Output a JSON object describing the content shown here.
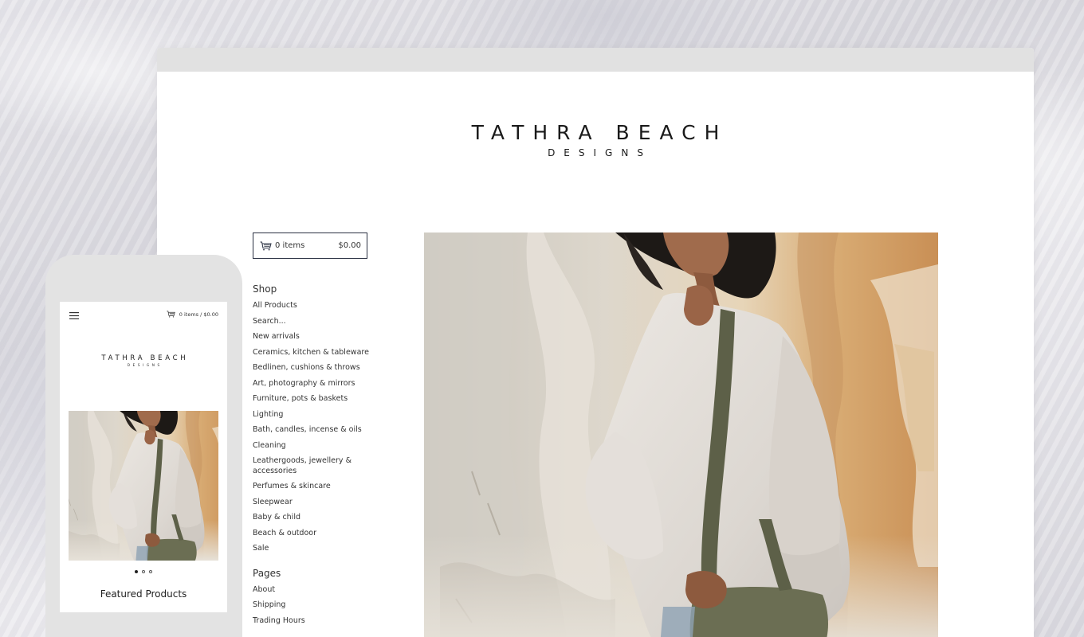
{
  "brand": {
    "name": "TATHRA BEACH",
    "tagline": "DESIGNS"
  },
  "cart": {
    "items": "0 items",
    "total": "$0.00",
    "mobile_summary": "0 items / $0.00"
  },
  "nav": {
    "shop_heading": "Shop",
    "shop_items": [
      "All Products",
      "Search...",
      "New arrivals",
      "Ceramics, kitchen & tableware",
      "Bedlinen, cushions & throws",
      "Art, photography & mirrors",
      "Furniture, pots & baskets",
      "Lighting",
      "Bath, candles, incense & oils",
      "Cleaning",
      "Leathergoods, jewellery & accessories",
      "Perfumes & skincare",
      "Sleepwear",
      "Baby & child",
      "Beach & outdoor",
      "Sale"
    ],
    "pages_heading": "Pages",
    "pages_items": [
      "About",
      "Shipping",
      "Trading Hours"
    ]
  },
  "mobile": {
    "featured_heading": "Featured Products",
    "slideshow": {
      "slides": 3,
      "active": 1
    }
  },
  "icons": {
    "cart": "cart-icon",
    "menu": "hamburger-menu-icon"
  },
  "colors": {
    "cart_border": "#2a3042",
    "browser_bar": "#e1e1e1",
    "phone_frame": "#e3e3e3"
  }
}
